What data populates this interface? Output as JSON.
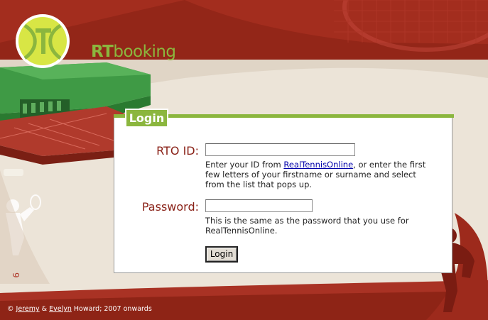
{
  "brand": {
    "name_bold": "RT",
    "name_light": "booking"
  },
  "login": {
    "title": "Login",
    "rto_label": "RTO ID:",
    "rto_value": "",
    "rto_help_prefix": "Enter your ID from ",
    "rto_help_link": "RealTennisOnline",
    "rto_help_suffix": ", or enter the first few letters of your firstname or surname and select from the list that pops up.",
    "password_label": "Password:",
    "password_value": "",
    "password_help": "This is the same as the password that you use for RealTennisOnline.",
    "button_label": "Login"
  },
  "footer": {
    "copyright": "©",
    "name1": "Jeremy",
    "amp": "&",
    "name2": "Evelyn",
    "suffix": "Howard; 2007 onwards"
  },
  "colors": {
    "accent_green": "#8bb63e",
    "dark_red": "#8a2218",
    "bg_cream": "#ece4d8"
  }
}
